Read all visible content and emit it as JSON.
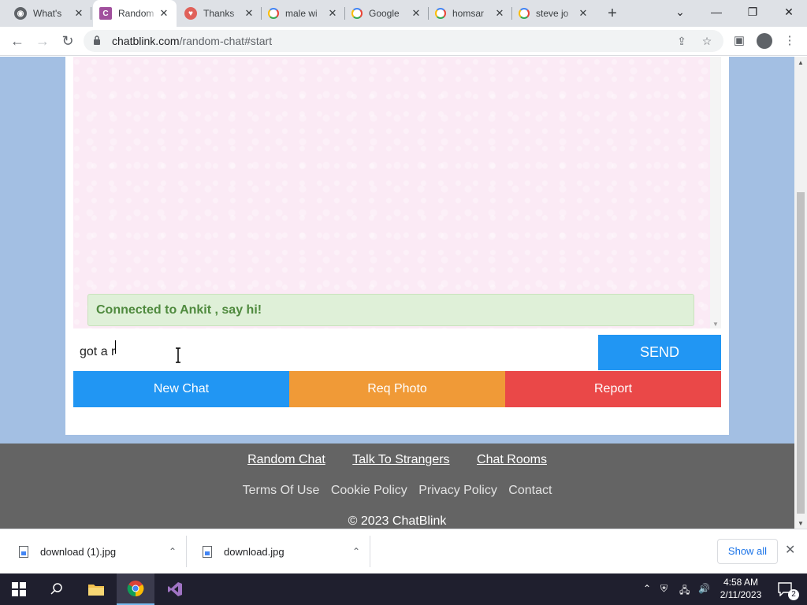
{
  "browser": {
    "tabs": [
      {
        "title": "What's",
        "favicon": "chrome-favicon",
        "active": false
      },
      {
        "title": "Random",
        "favicon": "chatblink-favicon",
        "active": true
      },
      {
        "title": "Thanks",
        "favicon": "thanks-favicon",
        "active": false
      },
      {
        "title": "male wi",
        "favicon": "google-favicon",
        "active": false
      },
      {
        "title": "Google",
        "favicon": "google-favicon",
        "active": false
      },
      {
        "title": "homsar",
        "favicon": "google-favicon",
        "active": false
      },
      {
        "title": "steve jo",
        "favicon": "google-favicon",
        "active": false
      }
    ],
    "url_host": "chatblink.com",
    "url_path": "/random-chat#start"
  },
  "chat": {
    "status_message": "Connected to Ankit , say hi!",
    "input_value": "got a r",
    "send_label": "SEND",
    "actions": {
      "new_chat": "New Chat",
      "req_photo": "Req Photo",
      "report": "Report"
    }
  },
  "footer": {
    "primary_links": [
      "Random Chat",
      "Talk To Strangers",
      "Chat Rooms"
    ],
    "secondary_links": [
      "Terms Of Use",
      "Cookie Policy",
      "Privacy Policy",
      "Contact"
    ],
    "copyright": "© 2023 ChatBlink"
  },
  "downloads": {
    "items": [
      "download (1).jpg",
      "download.jpg"
    ],
    "show_all_label": "Show all"
  },
  "taskbar": {
    "time": "4:58 AM",
    "date": "2/11/2023",
    "notification_count": "2"
  },
  "colors": {
    "send": "#2196f3",
    "new_chat": "#2196f3",
    "req_photo": "#f09a37",
    "report": "#ea4848",
    "page_background": "#a3bfe3",
    "status_text": "#4f8a3e"
  }
}
